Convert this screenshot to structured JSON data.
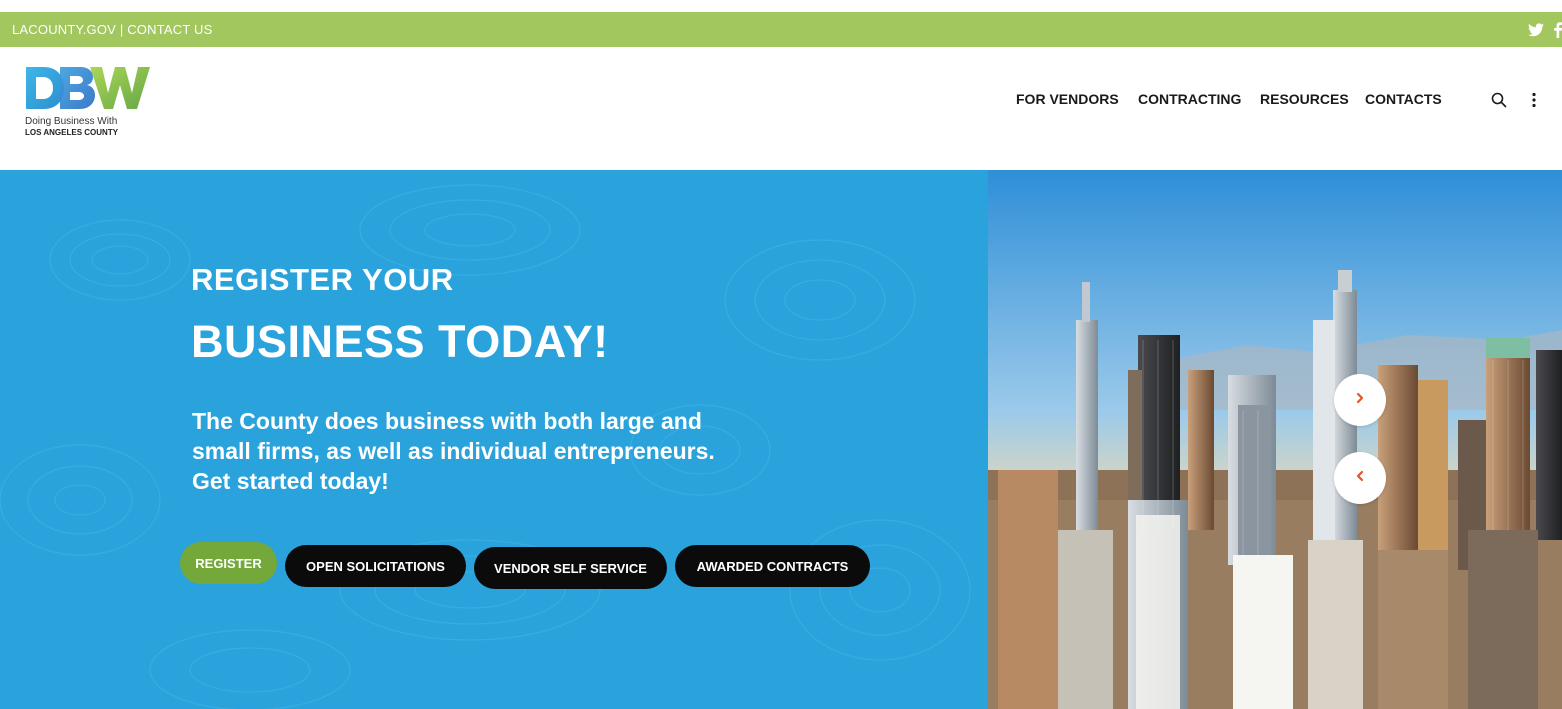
{
  "utility": {
    "links": "LACOUNTY.GOV | CONTACT US",
    "social_icons": [
      "twitter-icon",
      "facebook-icon"
    ]
  },
  "logo": {
    "mark": "DBW",
    "line1": "Doing Business With",
    "line2": "LOS ANGELES COUNTY"
  },
  "nav": {
    "items": [
      "FOR VENDORS",
      "CONTRACTING",
      "RESOURCES",
      "CONTACTS"
    ],
    "icons": [
      "search-icon",
      "more-vertical-icon"
    ]
  },
  "hero": {
    "line1": "REGISTER YOUR",
    "line2": "BUSINESS TODAY!",
    "text": "The County does business with both large and small firms, as well as individual entrepreneurs. Get started today!",
    "buttons": [
      "REGISTER",
      "OPEN SOLICITATIONS",
      "VENDOR SELF SERVICE",
      "AWARDED CONTRACTS"
    ]
  },
  "slider": {
    "next_icon": "chevron-right-icon",
    "prev_icon": "chevron-left-icon"
  },
  "colors": {
    "utility_bar": "#a3c75f",
    "hero_blue": "#2aa3dc",
    "register_green": "#75a83a",
    "button_black": "#0b0b0b",
    "arrow_red": "#e8532a"
  }
}
